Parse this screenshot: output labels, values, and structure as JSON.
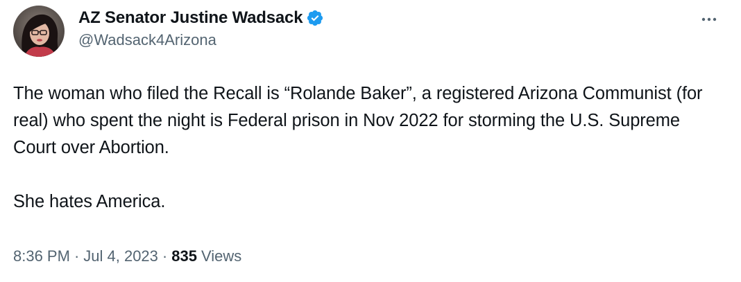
{
  "author": {
    "display_name": "AZ Senator Justine Wadsack",
    "handle": "@Wadsack4Arizona",
    "verified": true
  },
  "tweet": {
    "paragraphs": [
      "The woman who filed the Recall is “Rolande Baker”, a registered Arizona Communist (for real) who spent the night is Federal prison in Nov 2022 for storming the U.S. Supreme Court over Abortion.",
      "She hates America."
    ],
    "time": "8:36 PM",
    "separator": "·",
    "date": "Jul 4, 2023",
    "views_count": "835",
    "views_label": "Views"
  },
  "icons": {
    "verified": "verified-badge-icon",
    "more": "more-options-icon"
  },
  "colors": {
    "text": "#0f1419",
    "secondary": "#536471",
    "verified_blue": "#1d9bf0"
  }
}
